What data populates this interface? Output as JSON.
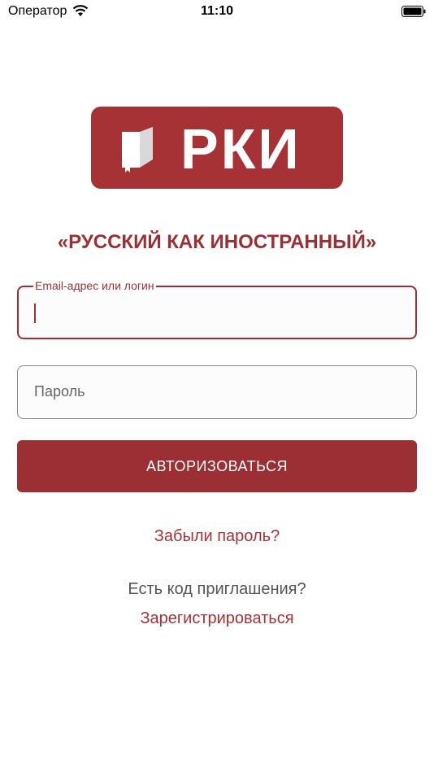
{
  "status_bar": {
    "carrier": "Оператор",
    "time": "11:10",
    "icons": [
      "wifi-icon",
      "battery-icon"
    ]
  },
  "logo": {
    "text": "РКИ",
    "background_color": "#a63236"
  },
  "tagline": "«РУССКИЙ КАК ИНОСТРАННЫЙ»",
  "form": {
    "email_label": "Email-адрес или логин",
    "email_value": "",
    "password_placeholder": "Пароль",
    "submit_label": "АВТОРИЗОВАТЬСЯ"
  },
  "links": {
    "forgot_password": "Забыли пароль?",
    "invite_question": "Есть код приглашения?",
    "register": "Зарегистрироваться"
  },
  "colors": {
    "accent": "#9c2f33",
    "link": "#a63236"
  }
}
